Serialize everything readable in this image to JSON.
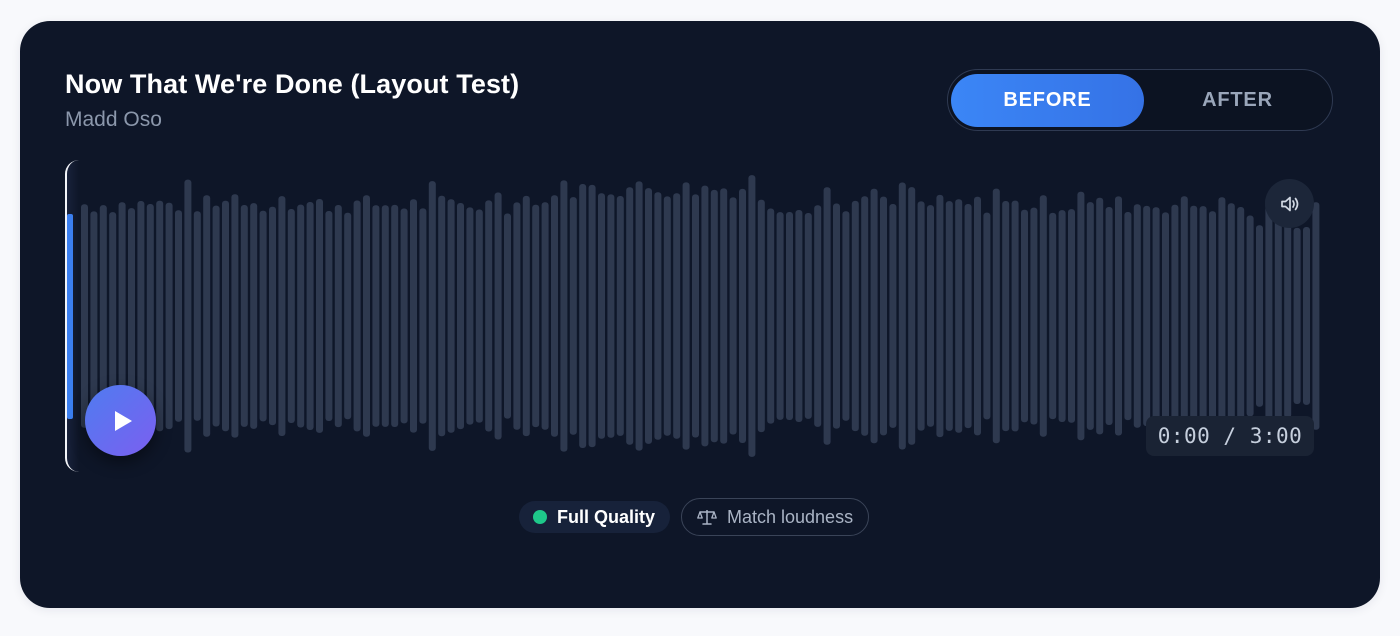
{
  "track": {
    "title": "Now That We're Done (Layout Test)",
    "artist": "Madd Oso"
  },
  "toggle": {
    "before_label": "BEFORE",
    "after_label": "AFTER",
    "selected": "BEFORE"
  },
  "player": {
    "time_display": "0:00 / 3:00",
    "play_icon": "play-icon",
    "volume_icon": "volume-icon",
    "progress": 0
  },
  "status": {
    "quality_label": "Full Quality",
    "quality_color": "#1ec88a",
    "loudness_label": "Match loudness",
    "loudness_icon": "scale-icon"
  },
  "colors": {
    "accent": "#3b7ff0",
    "card_bg": "#0e1628",
    "waveform": "#2e394f"
  }
}
